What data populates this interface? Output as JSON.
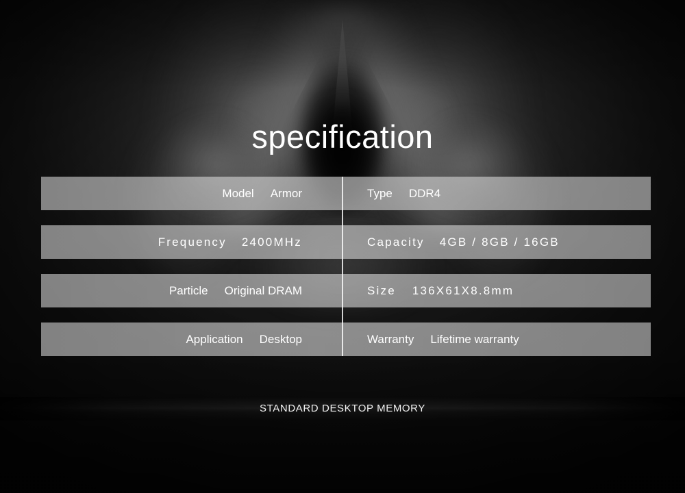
{
  "page": {
    "title": "specification",
    "footer_caption": "STANDARD DESKTOP MEMORY",
    "background_art": "armored-hooded-figure-silhouette",
    "colors": {
      "background": "#141414",
      "row_overlay": "#aaaaaa",
      "text": "#ffffff",
      "divider": "#ffffff"
    }
  },
  "spec_table": {
    "column_divider": true,
    "rows": [
      {
        "left": {
          "label": "Model",
          "value": "Armor"
        },
        "right": {
          "label": "Type",
          "value": "DDR4"
        },
        "tracking": "normal"
      },
      {
        "left": {
          "label": "Frequency",
          "value": "2400MHz"
        },
        "right": {
          "label": "Capacity",
          "value": "4GB / 8GB / 16GB"
        },
        "tracking": "wide"
      },
      {
        "left": {
          "label": "Particle",
          "value": "Original DRAM"
        },
        "right": {
          "label": "Size",
          "value": "136X61X8.8mm"
        },
        "tracking": "mixed"
      },
      {
        "left": {
          "label": "Application",
          "value": "Desktop"
        },
        "right": {
          "label": "Warranty",
          "value": "Lifetime warranty"
        },
        "tracking": "normal"
      }
    ]
  }
}
